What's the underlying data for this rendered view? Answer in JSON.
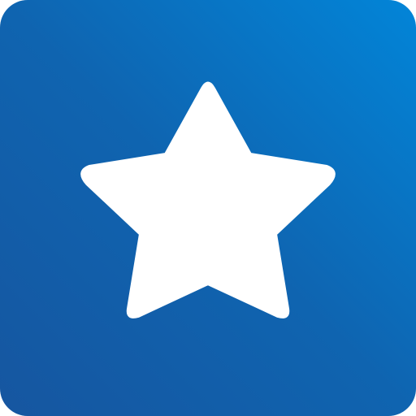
{
  "icon": {
    "name": "star-icon",
    "glyph_color": "#ffffff",
    "background_gradient": [
      "#0285d8",
      "#0f64b0",
      "#1656a0"
    ]
  }
}
